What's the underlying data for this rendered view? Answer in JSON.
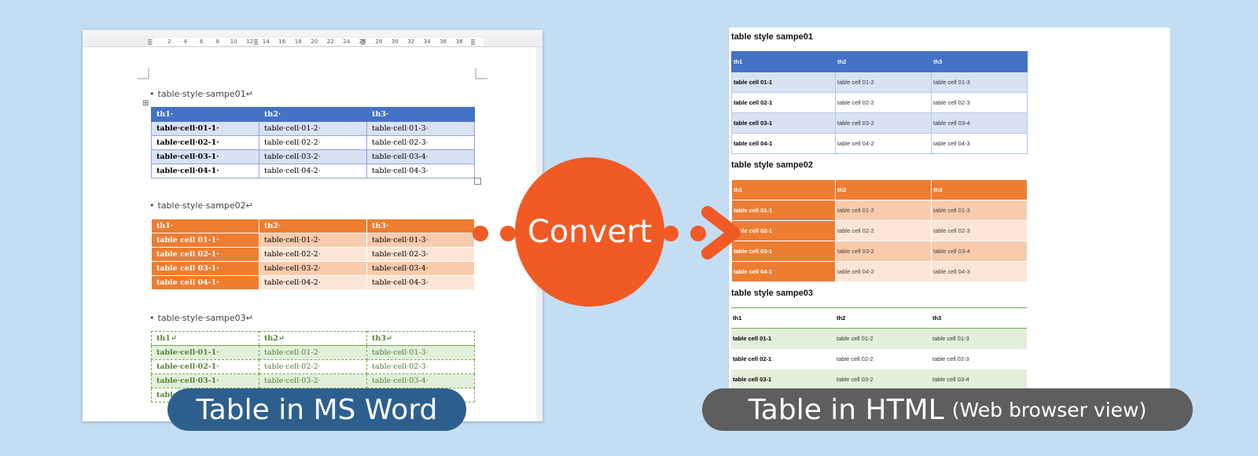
{
  "word_panel": {
    "ruler_ticks": [
      "2",
      "4",
      "6",
      "8",
      "10",
      "12",
      "14",
      "16",
      "18",
      "20",
      "22",
      "24",
      "26",
      "28",
      "30",
      "32",
      "34",
      "36",
      "38"
    ],
    "tables": [
      {
        "heading": "table·style·sampe01↵",
        "header": [
          "th1·",
          "th2·",
          "th3·"
        ],
        "rows": [
          [
            "table·cell·01-1·",
            "table·cell·01-2·",
            "table·cell·01-3·"
          ],
          [
            "table·cell·02-1·",
            "table·cell·02-2·",
            "table·cell·02-3·"
          ],
          [
            "table·cell·03-1·",
            "table·cell·03-2·",
            "table·cell·03-4·"
          ],
          [
            "table·cell·04-1·",
            "table·cell·04-2·",
            "table·cell·04-3·"
          ]
        ]
      },
      {
        "heading": "table·style·sampe02↵",
        "header": [
          "th1·",
          "th2·",
          "th3·"
        ],
        "rows": [
          [
            "table cell 01-1·",
            "table·cell·01-2·",
            "table·cell·01-3·"
          ],
          [
            "table cell 02-1·",
            "table·cell·02-2·",
            "table·cell·02-3·"
          ],
          [
            "table cell 03-1·",
            "table·cell·03-2·",
            "table·cell·03-4·"
          ],
          [
            "table cell 04-1·",
            "table·cell·04-2·",
            "table·cell·04-3·"
          ]
        ]
      },
      {
        "heading": "table·style·sampe03↵",
        "header": [
          "th1↵",
          "th2↵",
          "th3↵"
        ],
        "rows": [
          [
            "table·cell·01-1·",
            "table·cell·01-2·",
            "table·cell·01-3·"
          ],
          [
            "table·cell·02-1·",
            "table·cell·02-2·",
            "table·cell·02-3·"
          ],
          [
            "table·cell·03-1·",
            "table·cell·03-2·",
            "table·cell·03-4·"
          ],
          [
            "table",
            "",
            ""
          ]
        ]
      }
    ]
  },
  "html_panel": {
    "tables": [
      {
        "title": "table style sampe01",
        "header": [
          "th1",
          "th2",
          "th3"
        ],
        "rows": [
          [
            "table cell 01-1",
            "table cell 01-2",
            "table cell 01-3"
          ],
          [
            "table cell 02-1",
            "table cell 02-2",
            "table cell 02-3"
          ],
          [
            "table cell 03-1",
            "table cell 03-2",
            "table cell 03-4"
          ],
          [
            "table cell 04-1",
            "table cell 04-2",
            "table cell 04-3"
          ]
        ]
      },
      {
        "title": "table style sampe02",
        "header": [
          "th1",
          "th2",
          "th3"
        ],
        "rows": [
          [
            "table cell 01-1",
            "table cell 01-2",
            "table cell 01-3"
          ],
          [
            "table cell 02-1",
            "table cell 02-2",
            "table cell 02-3"
          ],
          [
            "table cell 03-1",
            "table cell 03-2",
            "table cell 03-4"
          ],
          [
            "table cell 04-1",
            "table cell 04-2",
            "table cell 04-3"
          ]
        ]
      },
      {
        "title": "table style sampe03",
        "header": [
          "th1",
          "th2",
          "th3"
        ],
        "rows": [
          [
            "table cell 01-1",
            "table cell 01-2",
            "table cell 01-3"
          ],
          [
            "table cell 02-1",
            "table cell 02-2",
            "table cell 02-3"
          ],
          [
            "table cell 03-1",
            "table cell 03-2",
            "table cell 03-4"
          ]
        ]
      }
    ]
  },
  "convert_label": "Convert",
  "captions": {
    "word": "Table in MS Word",
    "html_main": "Table in HTML",
    "html_sub": "(Web browser view)"
  },
  "colors": {
    "background": "#c3ddf3",
    "accent_orange": "#f15a24",
    "style01_header": "#4472c4",
    "style02_header": "#ed7d31",
    "style03_accent": "#70ad47",
    "caption_word": "#2d5f8e",
    "caption_html": "#5e5e5e"
  }
}
